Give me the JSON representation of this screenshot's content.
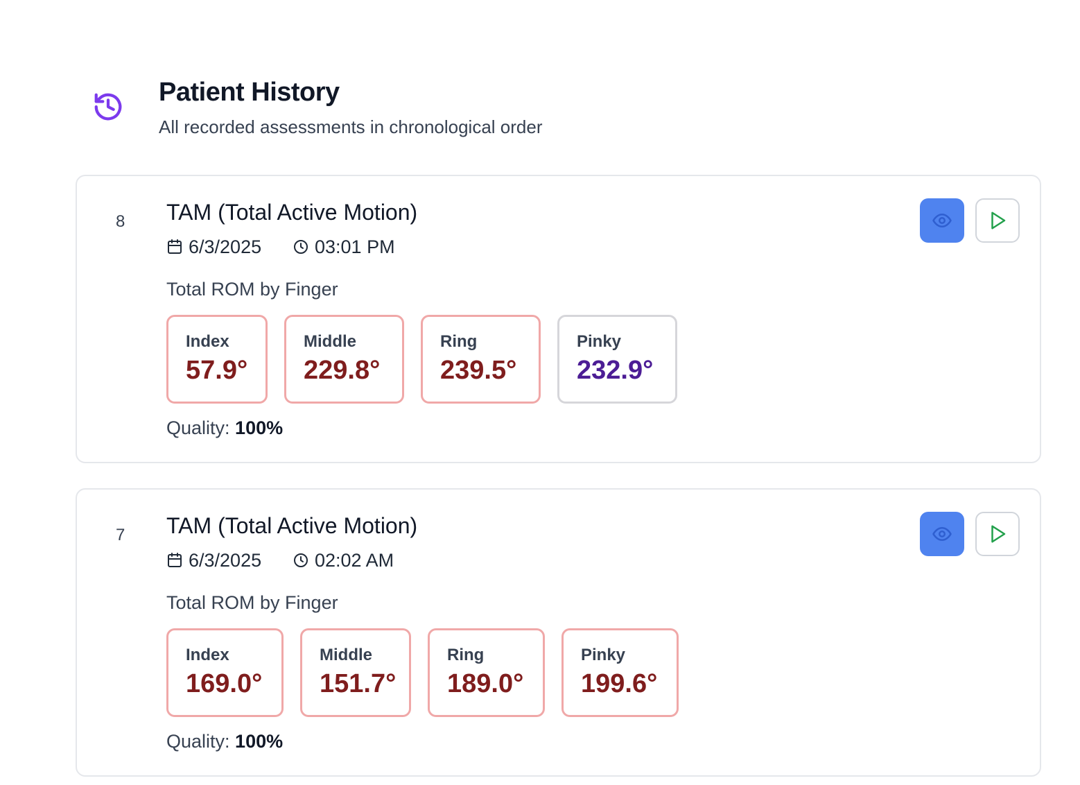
{
  "header": {
    "icon": "history-icon",
    "title": "Patient History",
    "subtitle": "All recorded assessments in chronological order",
    "accent_color": "#7c3aed"
  },
  "assessments": [
    {
      "index": "8",
      "title": "TAM (Total Active Motion)",
      "date": "6/3/2025",
      "time": "03:01 PM",
      "rom_label": "Total ROM by Finger",
      "fingers": [
        {
          "name": "Index",
          "value": "57.9°",
          "status": "abnormal"
        },
        {
          "name": "Middle",
          "value": "229.8°",
          "status": "abnormal"
        },
        {
          "name": "Ring",
          "value": "239.5°",
          "status": "abnormal"
        },
        {
          "name": "Pinky",
          "value": "232.9°",
          "status": "normal"
        }
      ],
      "quality_label": "Quality:",
      "quality_value": "100%"
    },
    {
      "index": "7",
      "title": "TAM (Total Active Motion)",
      "date": "6/3/2025",
      "time": "02:02 AM",
      "rom_label": "Total ROM by Finger",
      "fingers": [
        {
          "name": "Index",
          "value": "169.0°",
          "status": "abnormal"
        },
        {
          "name": "Middle",
          "value": "151.7°",
          "status": "abnormal"
        },
        {
          "name": "Ring",
          "value": "189.0°",
          "status": "abnormal"
        },
        {
          "name": "Pinky",
          "value": "199.6°",
          "status": "abnormal"
        }
      ],
      "quality_label": "Quality:",
      "quality_value": "100%"
    }
  ],
  "colors": {
    "view_button": "#4f83ef",
    "play_icon": "#22a04b",
    "abnormal_border": "#f0a8a8",
    "abnormal_value": "#7f1d1d",
    "normal_border": "#d6d6da",
    "normal_value": "#4c1d95"
  }
}
